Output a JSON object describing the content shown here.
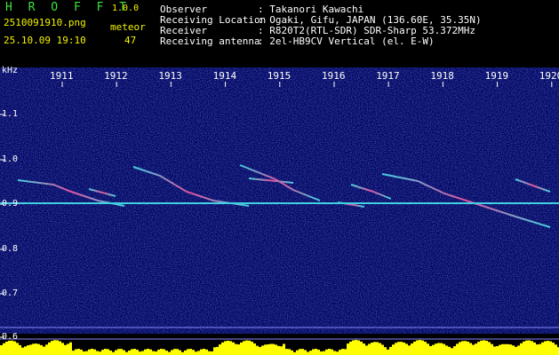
{
  "app": {
    "title": "H R O F F T",
    "version": "1.0.0"
  },
  "file": {
    "name": "2510091910.png",
    "datetime": "25.10.09 19:10"
  },
  "meteor": {
    "label": "meteor",
    "count": "47"
  },
  "info": [
    {
      "key": "Observer",
      "value": ": Takanori Kawachi"
    },
    {
      "key": "Receiving Location",
      "value": ": Ogaki, Gifu, JAPAN (136.60E, 35.35N)"
    },
    {
      "key": "Receiver",
      "value": ": R820T2(RTL-SDR) SDR-Sharp 53.372MHz"
    },
    {
      "key": "Receiving antenna",
      "value": ": 2el-HB9CV Vertical (el. E-W)"
    }
  ],
  "axis": {
    "unit": "kHz",
    "y_ticks": [
      "1.1",
      "1.0",
      "0.9",
      "0.8",
      "0.7",
      "0.6"
    ],
    "y_values": [
      1.1,
      1.0,
      0.9,
      0.8,
      0.7,
      0.6
    ],
    "x_ticks": [
      "1911",
      "1912",
      "1913",
      "1914",
      "1915",
      "1916",
      "1917",
      "1918",
      "1919",
      "1920"
    ]
  },
  "colors": {
    "background": "#03035e",
    "carrier": "#40d0e0",
    "level": "#ffff00",
    "brand": "#3fe23f"
  }
}
